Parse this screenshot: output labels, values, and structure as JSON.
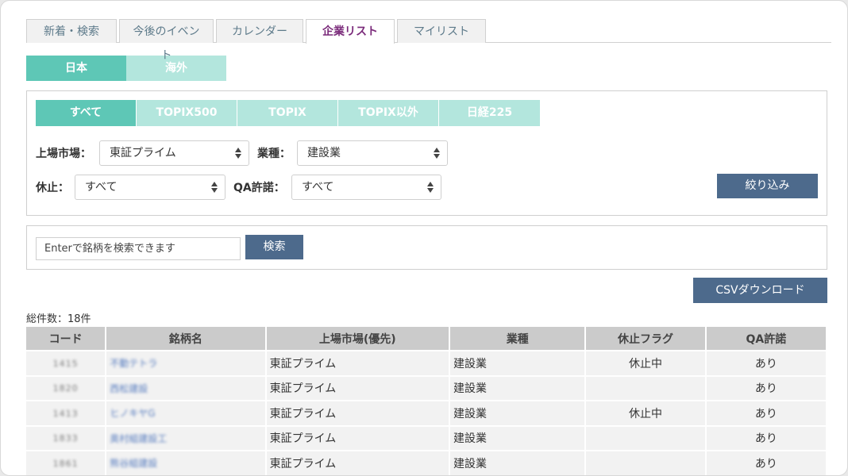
{
  "tabs": [
    {
      "label": "新着・検索",
      "active": false
    },
    {
      "label": "今後のイベント",
      "active": false
    },
    {
      "label": "カレンダー",
      "active": false
    },
    {
      "label": "企業リスト",
      "active": true
    },
    {
      "label": "マイリスト",
      "active": false
    }
  ],
  "region": {
    "japan": "日本",
    "overseas": "海外",
    "selected": "日本"
  },
  "index_tabs": [
    "すべて",
    "TOPIX500",
    "TOPIX",
    "TOPIX以外",
    "日経225"
  ],
  "index_selected": "すべて",
  "filters": {
    "market_label": "上場市場：",
    "market_value": "東証プライム",
    "industry_label": "業種：",
    "industry_value": "建設業",
    "suspension_label": "休止：",
    "suspension_value": "すべて",
    "qa_label": "QA許諾：",
    "qa_value": "すべて",
    "filter_button": "絞り込み"
  },
  "search": {
    "placeholder": "Enterで銘柄を検索できます",
    "button": "検索"
  },
  "csv_button": "CSVダウンロード",
  "total": "総件数：18件",
  "table": {
    "headers": [
      "コード",
      "銘柄名",
      "上場市場(優先)",
      "業種",
      "休止フラグ",
      "QA許諾"
    ],
    "rows": [
      {
        "code": "1415",
        "name": "不動テトラ",
        "market": "東証プライム",
        "industry": "建設業",
        "suspension": "休止中",
        "qa": "あり"
      },
      {
        "code": "1820",
        "name": "西松建設",
        "market": "東証プライム",
        "industry": "建設業",
        "suspension": "",
        "qa": "あり"
      },
      {
        "code": "1413",
        "name": "ヒノキヤG",
        "market": "東証プライム",
        "industry": "建設業",
        "suspension": "休止中",
        "qa": "あり"
      },
      {
        "code": "1833",
        "name": "奥村組建設工",
        "market": "東証プライム",
        "industry": "建設業",
        "suspension": "",
        "qa": "あり"
      },
      {
        "code": "1861",
        "name": "熊谷組建設",
        "market": "東証プライム",
        "industry": "建設業",
        "suspension": "",
        "qa": "あり"
      }
    ]
  },
  "colors": {
    "accent": "#5ec7b6",
    "accent_light": "#b3e6dd",
    "button": "#4d6a8c",
    "active_tab_text": "#7a2a7a"
  }
}
